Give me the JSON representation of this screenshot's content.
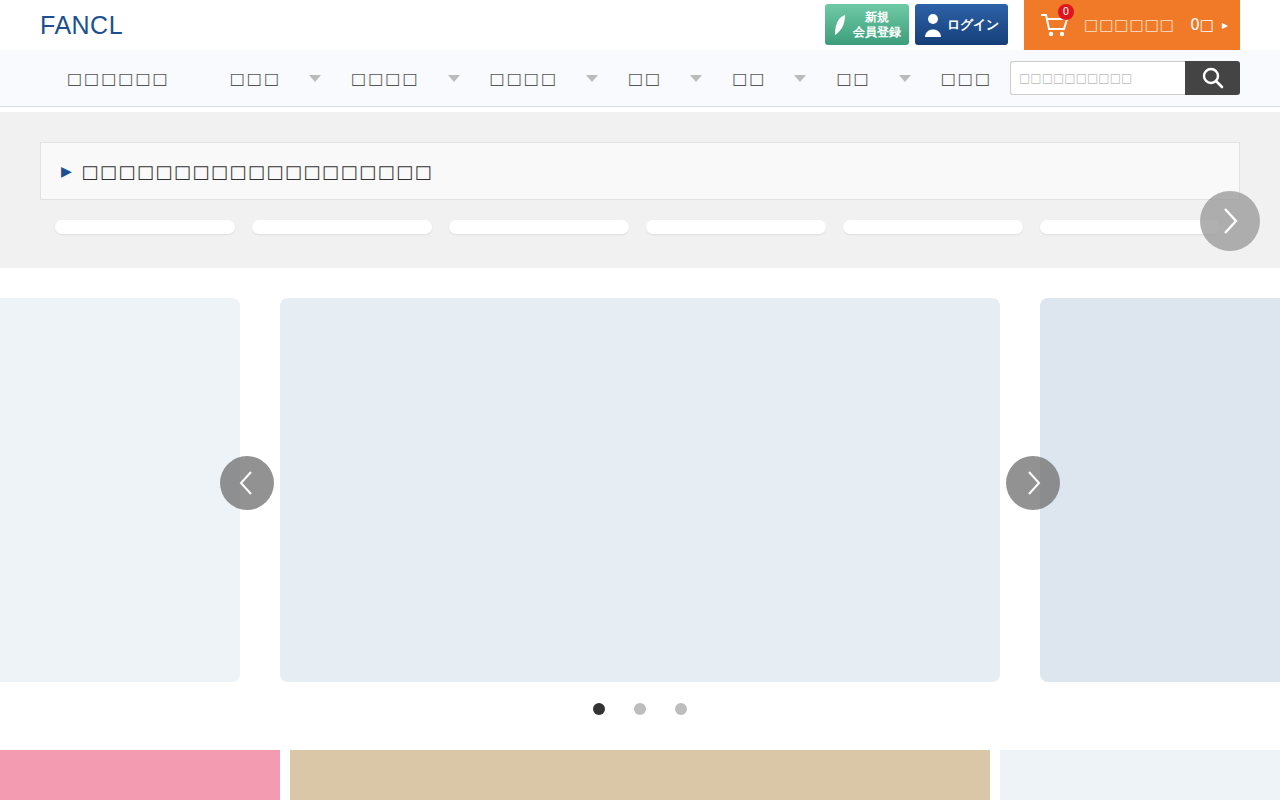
{
  "header": {
    "logo": "FANCL",
    "register_button": [
      "新規",
      "会員登録"
    ],
    "login_button": "ログイン",
    "cart": {
      "count": "0",
      "label": "□□□□□□",
      "total": "0□",
      "arrow": "▸"
    }
  },
  "nav": {
    "items": [
      {
        "label": "□□□□□□",
        "dropdown": false
      },
      {
        "label": "□□□",
        "dropdown": true
      },
      {
        "label": "□□□□",
        "dropdown": true
      },
      {
        "label": "□□□□",
        "dropdown": true
      },
      {
        "label": "□□",
        "dropdown": true
      },
      {
        "label": "□□",
        "dropdown": true
      },
      {
        "label": "□□",
        "dropdown": true
      },
      {
        "label": "□□□",
        "dropdown": false
      },
      {
        "label": "□□",
        "dropdown": false
      }
    ]
  },
  "search": {
    "placeholder": "□□□□□□□□□□"
  },
  "notice": {
    "marker": "▶",
    "text": "□□□□□□□□□□□□□□□□□□□"
  },
  "carousel": {
    "dots": [
      {
        "selected": true
      },
      {
        "selected": false
      },
      {
        "selected": false
      }
    ]
  }
}
